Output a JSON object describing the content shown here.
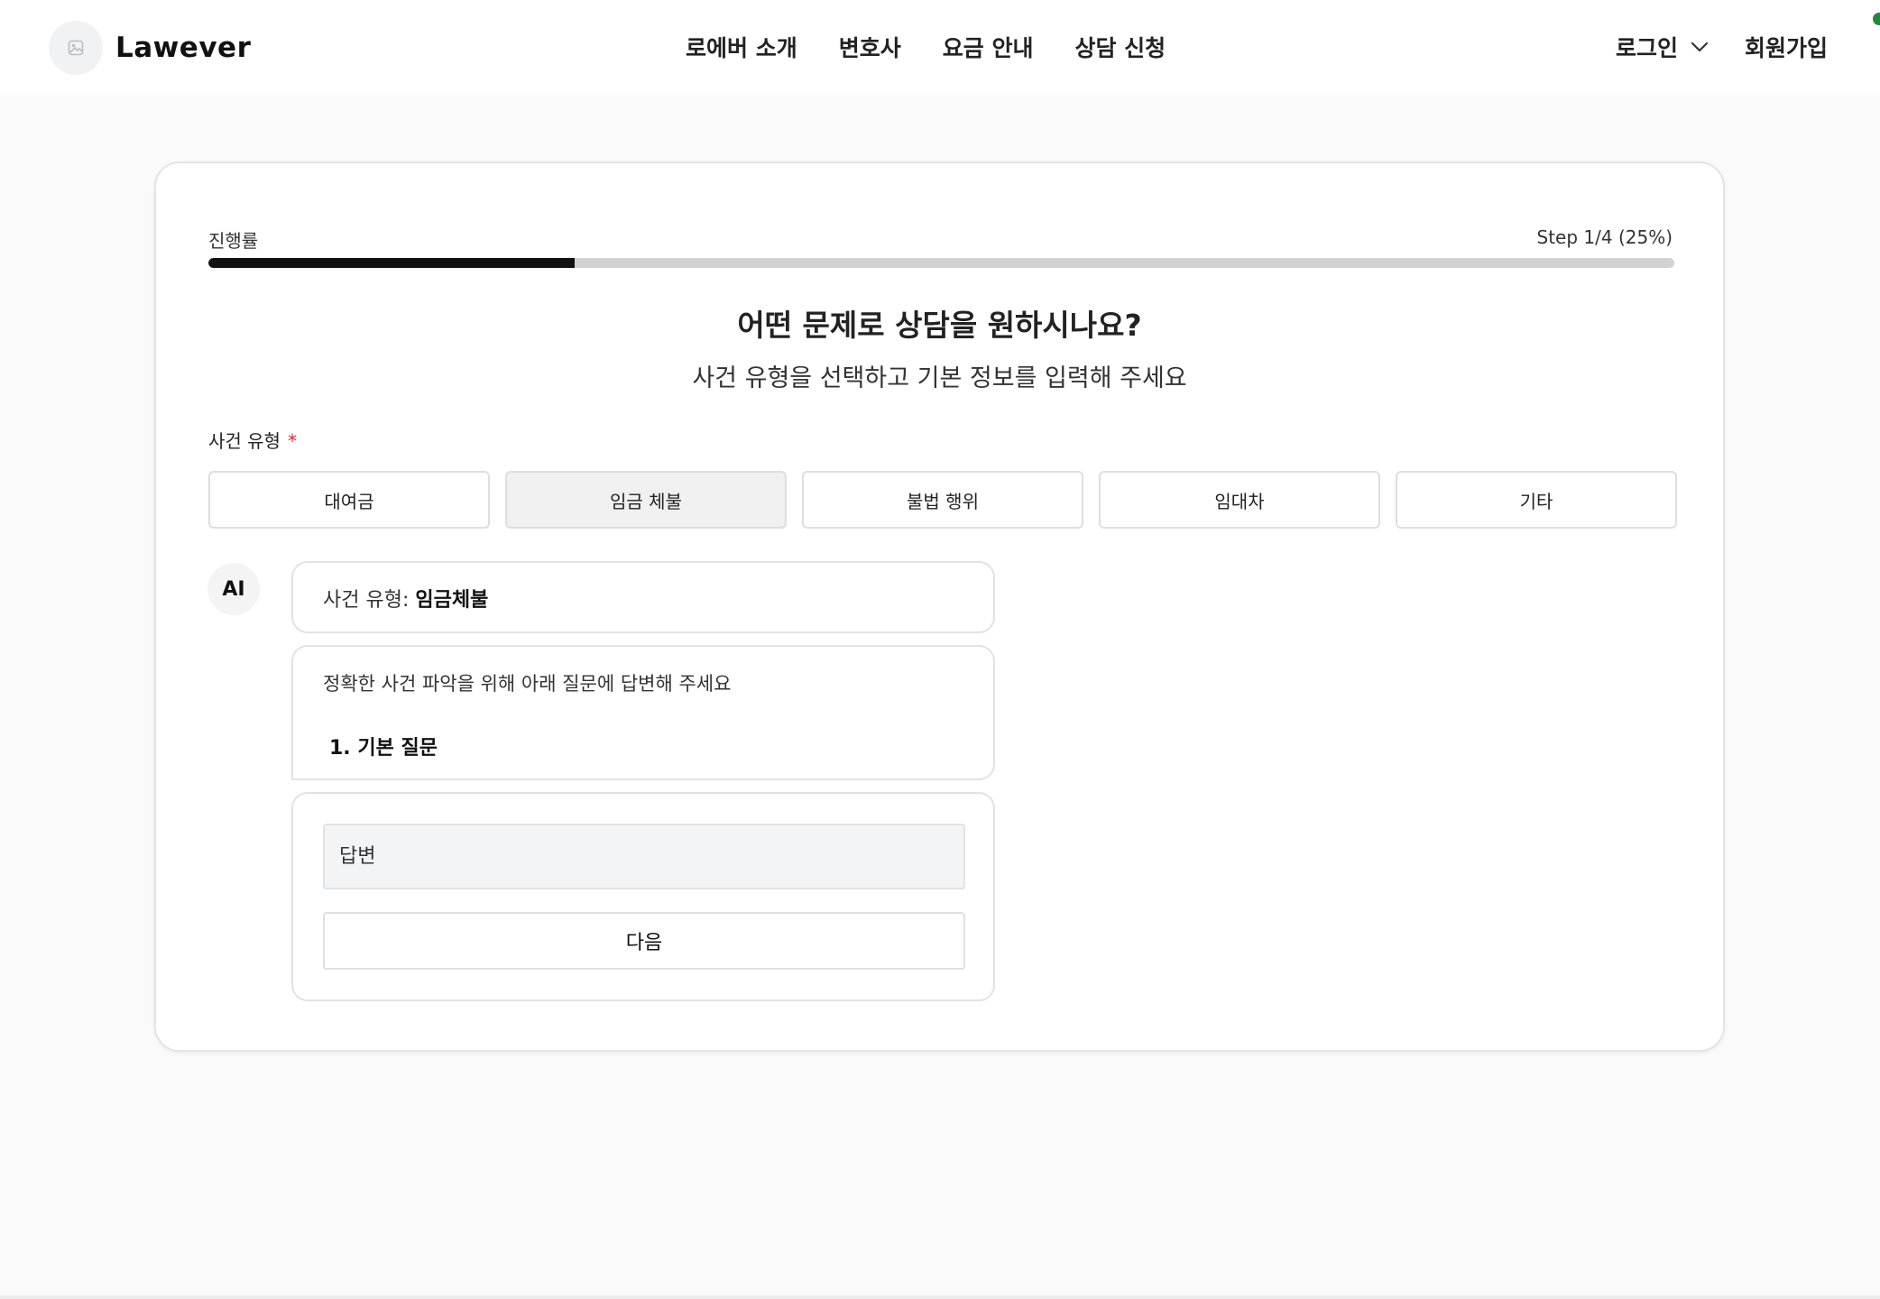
{
  "brand": {
    "name": "Lawever"
  },
  "nav": {
    "items": [
      {
        "label": "로에버 소개"
      },
      {
        "label": "변호사"
      },
      {
        "label": "요금 안내"
      },
      {
        "label": "상담 신청"
      }
    ]
  },
  "header": {
    "login_label": "로그인",
    "signup_label": "회원가입"
  },
  "progress": {
    "label": "진행률",
    "step_text": "Step 1/4 (25%)",
    "percent": 25
  },
  "form": {
    "title": "어떤 문제로 상담을 원하시나요?",
    "subtitle": "사건 유형을 선택하고 기본 정보를 입력해 주세요",
    "case_type_label": "사건 유형",
    "required_mark": "*",
    "case_types": [
      {
        "label": "대여금",
        "selected": false
      },
      {
        "label": "임금 체불",
        "selected": true
      },
      {
        "label": "불법 행위",
        "selected": false
      },
      {
        "label": "임대차",
        "selected": false
      },
      {
        "label": "기타",
        "selected": false
      }
    ]
  },
  "chat": {
    "avatar_label": "AI",
    "case_type_prefix": "사건 유형: ",
    "case_type_value": "임금체불",
    "instruction": "정확한 사건 파악을 위해 아래 질문에 답변해 주세요",
    "question": "1. 기본 질문",
    "answer_placeholder": "답변",
    "next_label": "다음"
  },
  "colors": {
    "progress_fill": "#111111",
    "progress_track": "#d2d2d2",
    "required": "#e5262b",
    "selected_bg": "#f0f0f0"
  }
}
